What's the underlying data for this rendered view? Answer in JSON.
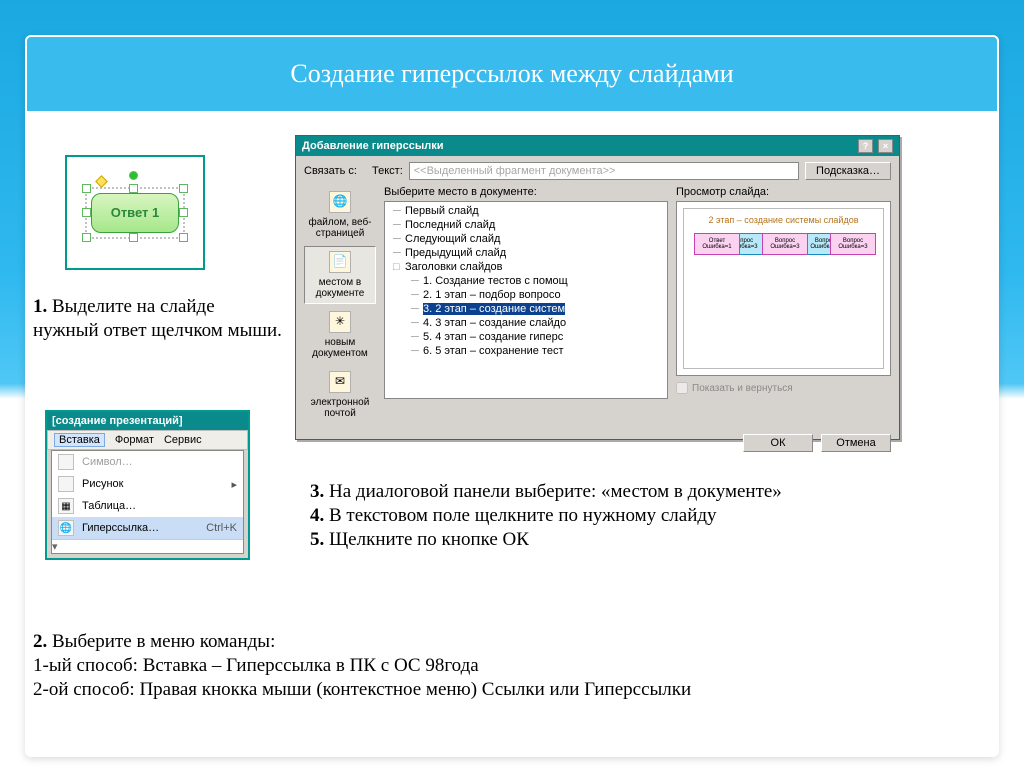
{
  "title": "Создание гиперссылок между слайдами",
  "answer_shape": {
    "label": "Ответ 1"
  },
  "dialog": {
    "title": "Добавление гиперссылки",
    "link_label": "Связать с:",
    "text_label": "Текст:",
    "text_placeholder": "<<Выделенный фрагмент документа>>",
    "hint_btn": "Подсказка…",
    "side": {
      "file": "файлом, веб-страницей",
      "place": "местом в документе",
      "newdoc": "новым документом",
      "email": "электронной почтой"
    },
    "choose_label": "Выберите место в документе:",
    "preview_label": "Просмотр слайда:",
    "tree": {
      "first": "Первый слайд",
      "last": "Последний слайд",
      "next": "Следующий слайд",
      "prev": "Предыдущий слайд",
      "titles": "Заголовки слайдов",
      "children": [
        "1. Создание тестов с помощ",
        "2. 1 этап – подбор вопросо",
        "3. 2 этап – создание систем",
        "4. 3 этап – создание слайдо",
        "5. 4 этап – создание гиперс",
        "6. 5 этап – сохранение тест"
      ]
    },
    "preview_slide_title": "2 этап – создание системы слайдов",
    "checkbox": "Показать и вернуться",
    "ok": "ОК",
    "cancel": "Отмена"
  },
  "menu": {
    "caption": "[создание презентаций]",
    "bar": [
      "Вставка",
      "Формат",
      "Сервис"
    ],
    "symbol": "Символ…",
    "picture": "Рисунок",
    "table": "Таблица…",
    "hyper": "Гиперссылка…",
    "shortcut": "Ctrl+K"
  },
  "steps": {
    "s1": "Выделите на слайде нужный ответ щелчком мыши.",
    "s2a": "Выберите в меню команды:",
    "s2b": "1-ый способ: Вставка – Гиперссылка в ПК с ОС 98года",
    "s2c": "2-ой способ: Правая кнокка мыши (контекстное меню) Ссылки или Гиперссылки",
    "s3a": "На диалоговой панели выберите: «местом в документе»",
    "s4": "В текстовом поле щелкните по нужному слайду",
    "s5": "Щелкните по кнопке ОК"
  }
}
